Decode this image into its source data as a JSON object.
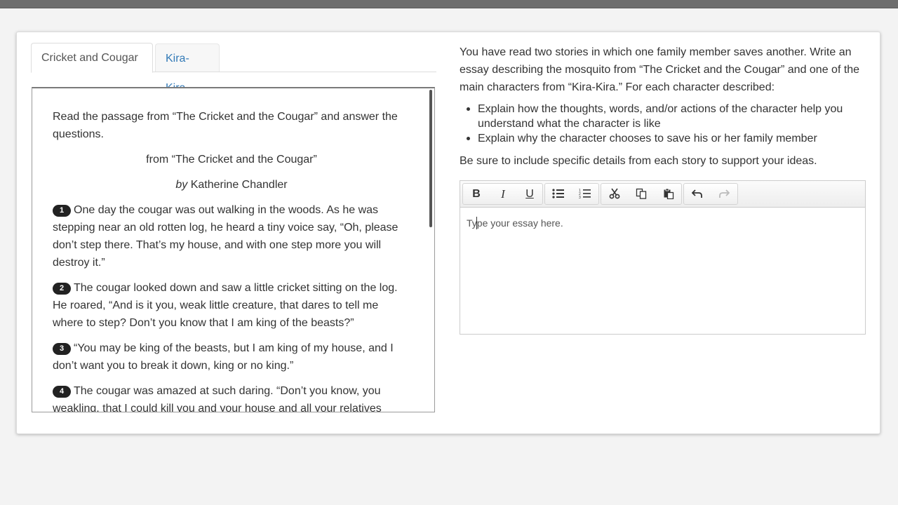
{
  "tabs": [
    {
      "label": "Cricket and Cougar",
      "active": true
    },
    {
      "label": "Kira-Kira",
      "active": false
    }
  ],
  "passage": {
    "intro": "Read the passage from “The Cricket and the Cougar” and answer the questions.",
    "title": "from “The Cricket and the Cougar”",
    "byline_prefix": "by",
    "byline_author": "Katherine Chandler",
    "paragraphs": [
      {
        "num": "1",
        "text": "One day the cougar was out walking in the woods. As he was stepping near an old rotten log, he heard a tiny voice say, “Oh, please don’t step there. That’s my house, and with one step more you will destroy it.”"
      },
      {
        "num": "2",
        "text": "The cougar looked down and saw a little cricket sitting on the log. He roared, “And is it you, weak little creature, that dares to tell me where to step? Don’t you know that I am king of the beasts?”"
      },
      {
        "num": "3",
        "text": "“You may be king of the beasts, but I am king of my house, and I don’t want you to break it down, king or no king.”"
      },
      {
        "num": "4",
        "text": "The cougar was amazed at such daring. “Don’t you know, you weakling, that I could kill you and your house and all your relatives"
      }
    ]
  },
  "prompt": {
    "intro": "You have read two stories in which one family member saves another. Write an essay describing the mosquito from “The Cricket and the Cougar” and one of the main characters from “Kira-Kira.” For each character described:",
    "bullets": [
      "Explain how the thoughts, words, and/or actions of the character help you understand what the character is like",
      "Explain why the character chooses to save his or her family member"
    ],
    "support": "Be sure to include specific details from each story to support your ideas."
  },
  "editor": {
    "placeholder": "Type your essay here.",
    "tools": {
      "bold": "B",
      "italic": "I",
      "underline": "U"
    }
  },
  "colors": {
    "link": "#337ab7",
    "top_bar": "#6e6e6e",
    "background": "#f3f3f3"
  }
}
